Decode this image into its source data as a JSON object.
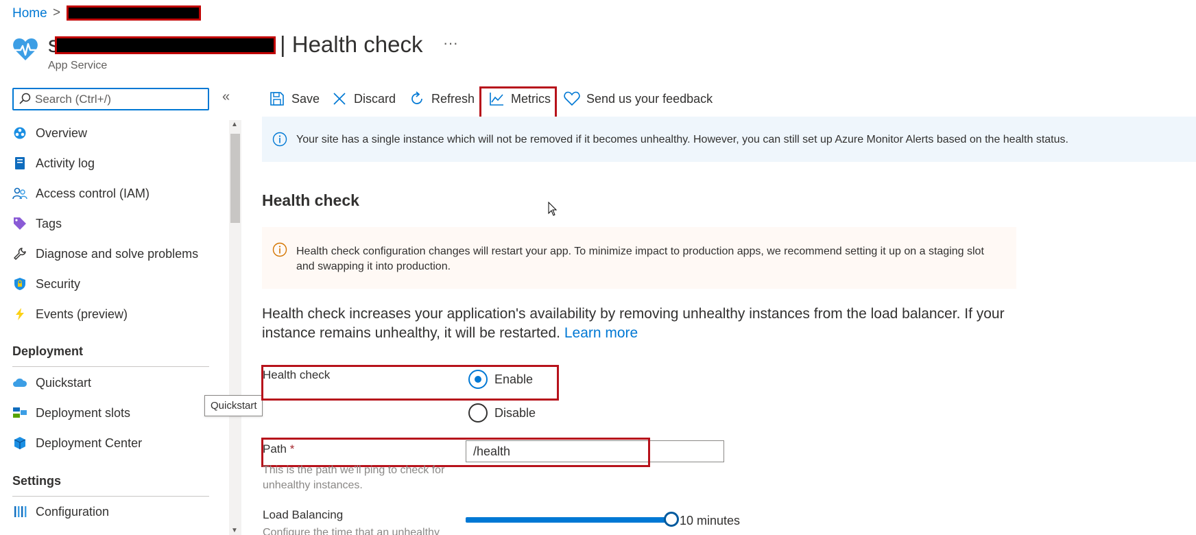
{
  "breadcrumb": {
    "home": "Home",
    "separator": ">"
  },
  "header": {
    "title_suffix": "| Health check",
    "subtitle": "App Service",
    "more": "···"
  },
  "search": {
    "placeholder": "Search (Ctrl+/)"
  },
  "sidebar": {
    "collapse": "«",
    "items": [
      {
        "label": "Overview",
        "icon": "overview-icon"
      },
      {
        "label": "Activity log",
        "icon": "activity-log-icon"
      },
      {
        "label": "Access control (IAM)",
        "icon": "people-icon"
      },
      {
        "label": "Tags",
        "icon": "tag-icon"
      },
      {
        "label": "Diagnose and solve problems",
        "icon": "wrench-icon"
      },
      {
        "label": "Security",
        "icon": "shield-icon"
      },
      {
        "label": "Events (preview)",
        "icon": "lightning-icon"
      }
    ],
    "deployment_heading": "Deployment",
    "deployment_items": [
      {
        "label": "Quickstart",
        "icon": "cloud-icon"
      },
      {
        "label": "Deployment slots",
        "icon": "slots-icon"
      },
      {
        "label": "Deployment Center",
        "icon": "cube-icon"
      }
    ],
    "settings_heading": "Settings",
    "settings_items": [
      {
        "label": "Configuration",
        "icon": "bars-icon"
      }
    ],
    "tooltip": "Quickstart"
  },
  "toolbar": {
    "save": "Save",
    "discard": "Discard",
    "refresh": "Refresh",
    "metrics": "Metrics",
    "feedback": "Send us your feedback"
  },
  "info_banner": "Your site has a single instance which will not be removed if it becomes unhealthy. However, you can still set up Azure Monitor Alerts based on the health status.",
  "section_heading": "Health check",
  "warning_banner": "Health check configuration changes will restart your app. To minimize impact to production apps, we recommend setting it up on a staging slot and swapping it into production.",
  "description": {
    "text": "Health check increases your application's availability by removing unhealthy instances from the load balancer. If your instance remains unhealthy, it will be restarted.",
    "link": "Learn more"
  },
  "form": {
    "health_check_label": "Health check",
    "enable": "Enable",
    "disable": "Disable",
    "selected": "Enable",
    "path_label": "Path",
    "required_mark": "*",
    "path_value": "/health",
    "path_help": "This is the path we'll ping to check for unhealthy instances.",
    "load_balancing_label": "Load Balancing",
    "load_balancing_value": "10 minutes",
    "load_balancing_help": "Configure the time that an unhealthy"
  },
  "colors": {
    "accent": "#0078d4",
    "highlight_border": "#b7121b",
    "info_bg": "#eff6fc",
    "warning_bg": "#fff9f5",
    "warning_icon": "#d47500"
  }
}
